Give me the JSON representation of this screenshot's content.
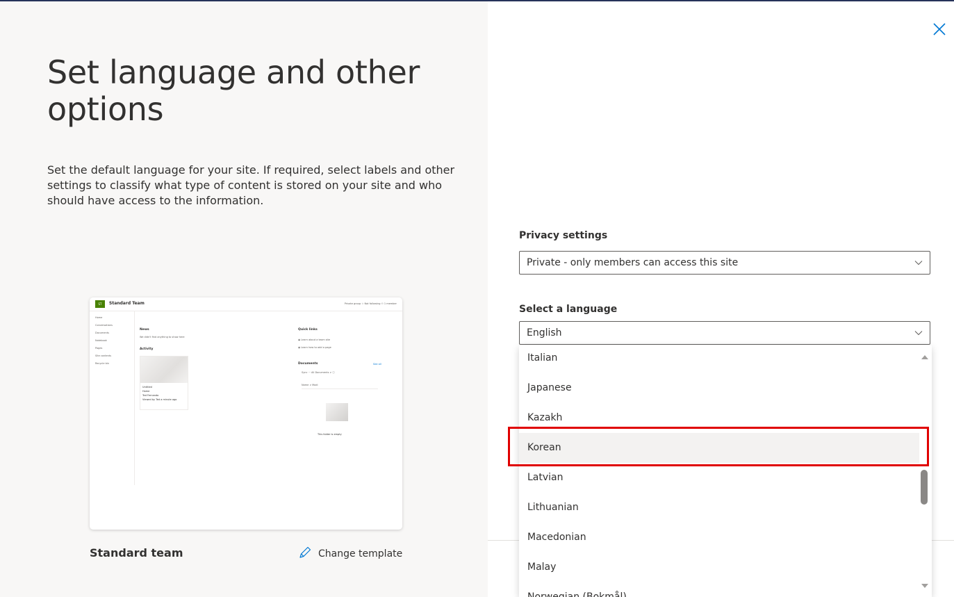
{
  "left_panel": {
    "title": "Set language and other options",
    "description": "Set the default language for your site. If required, select labels and other settings to classify what type of content is stored on your site and who should have access to the information.",
    "template_name": "Standard team",
    "change_template_label": "Change template",
    "preview": {
      "site_title": "Standard Team",
      "header_right": "Private group  ☆ Not following  ⚇ 1 member",
      "nav_items": [
        "Home",
        "Conversations",
        "Documents",
        "Notebook",
        "Pages",
        "Site contents",
        "Recycle bin"
      ],
      "news_heading": "News",
      "news_text": "We didn't find anything to show here",
      "activity_heading": "Activity",
      "card_title": "Untitled",
      "card_subtitle": "Home",
      "card_author": "Ted Fernando",
      "card_author_sub": "Viewed by Ted a minute ago",
      "quick_links_heading": "Quick links",
      "quick_links": [
        "Learn about a team site",
        "Learn how to add a page"
      ],
      "documents_heading": "Documents",
      "documents_see_all": "See all",
      "documents_toolbar": "Sync  ···      All Documents ∨  ⓘ",
      "documents_columns": "Name ∨                              Modi",
      "empty_text": "This folder is empty"
    }
  },
  "right_panel": {
    "privacy": {
      "label": "Privacy settings",
      "value": "Private - only members can access this site"
    },
    "language": {
      "label": "Select a language",
      "value": "English",
      "options": [
        "Italian",
        "Japanese",
        "Kazakh",
        "Korean",
        "Latvian",
        "Lithuanian",
        "Macedonian",
        "Malay",
        "Norwegian (Bokmål)"
      ],
      "highlighted": "Korean"
    }
  },
  "colors": {
    "left_bg": "#f8f7f6",
    "accent": "#0078d4",
    "highlight_border": "#e00000",
    "logo_green": "#498205"
  }
}
